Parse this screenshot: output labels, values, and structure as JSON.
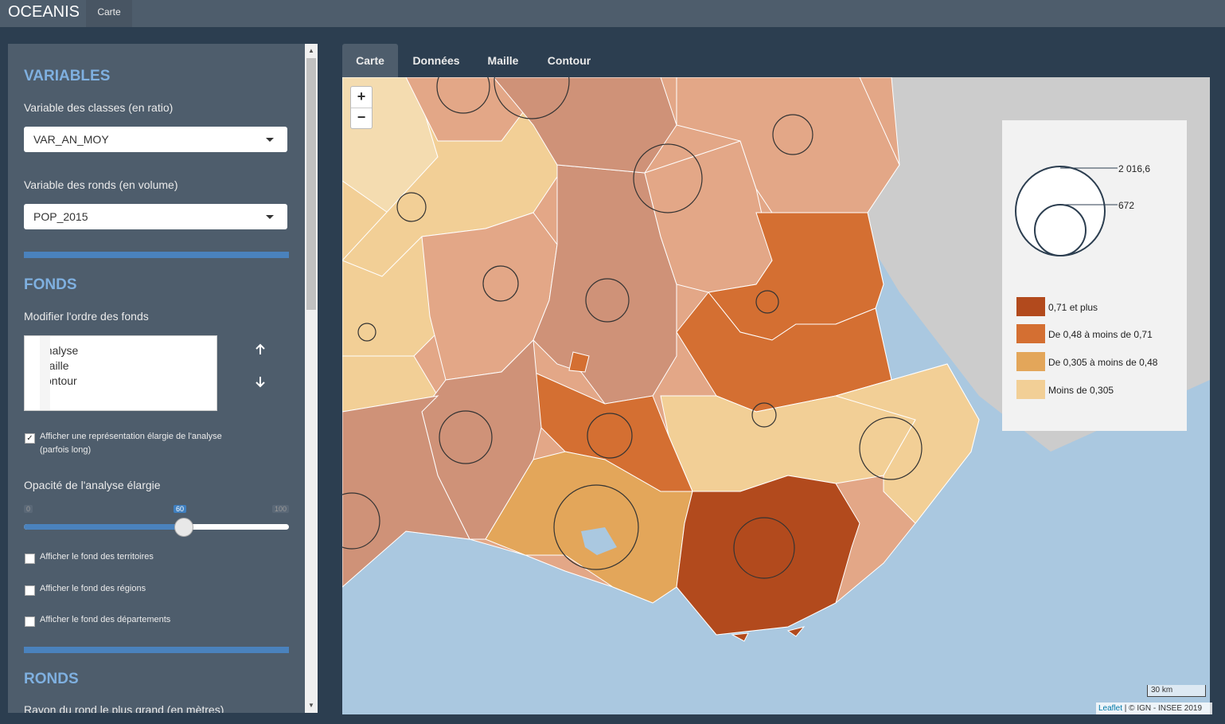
{
  "app": {
    "brand": "OCEANIS",
    "nav_tab": "Carte"
  },
  "sidebar": {
    "variables_title": "VARIABLES",
    "class_var_label": "Variable des classes (en ratio)",
    "class_var_value": "VAR_AN_MOY",
    "round_var_label": "Variable des ronds (en volume)",
    "round_var_value": "POP_2015",
    "fonds_title": "FONDS",
    "order_label": "Modifier l'ordre des fonds",
    "order_items": [
      "analyse",
      "maille",
      "contour"
    ],
    "extended_label_1": "Afficher une représentation élargie de l'analyse",
    "extended_label_2": "(parfois long)",
    "extended_checked": true,
    "opacity_label": "Opacité de l'analyse élargie",
    "opacity_min": "0",
    "opacity_max": "100",
    "opacity_value": "60",
    "opacity_fraction": 0.6,
    "territories_label": "Afficher le fond des territoires",
    "regions_label": "Afficher le fond des régions",
    "departments_label": "Afficher le fond des départements",
    "ronds_title": "RONDS",
    "radius_label": "Rayon du rond le plus grand (en mètres)"
  },
  "tabs": [
    "Carte",
    "Données",
    "Maille",
    "Contour"
  ],
  "map": {
    "zoom_in": "+",
    "zoom_out": "−",
    "legend": {
      "circle_max": "2 016,6",
      "circle_mid": "672",
      "classes": [
        {
          "label": "0,71 et plus",
          "color": "#b24a1d"
        },
        {
          "label": "De 0,48 à moins de 0,71",
          "color": "#d46f32"
        },
        {
          "label": "De 0,305 à moins de 0,48",
          "color": "#e3a65a"
        },
        {
          "label": "Moins de 0,305",
          "color": "#f2cf96"
        }
      ]
    },
    "scale": "30 km",
    "attribution_link": "Leaflet",
    "attribution_text": " | © IGN - INSEE 2019",
    "colors": {
      "sea": "#aac8e0",
      "foreign": "#cccccc",
      "light": "#f2cf96",
      "salmon": "#e3a787",
      "brown": "#cf9278",
      "pale": "#f4dcb0"
    }
  }
}
